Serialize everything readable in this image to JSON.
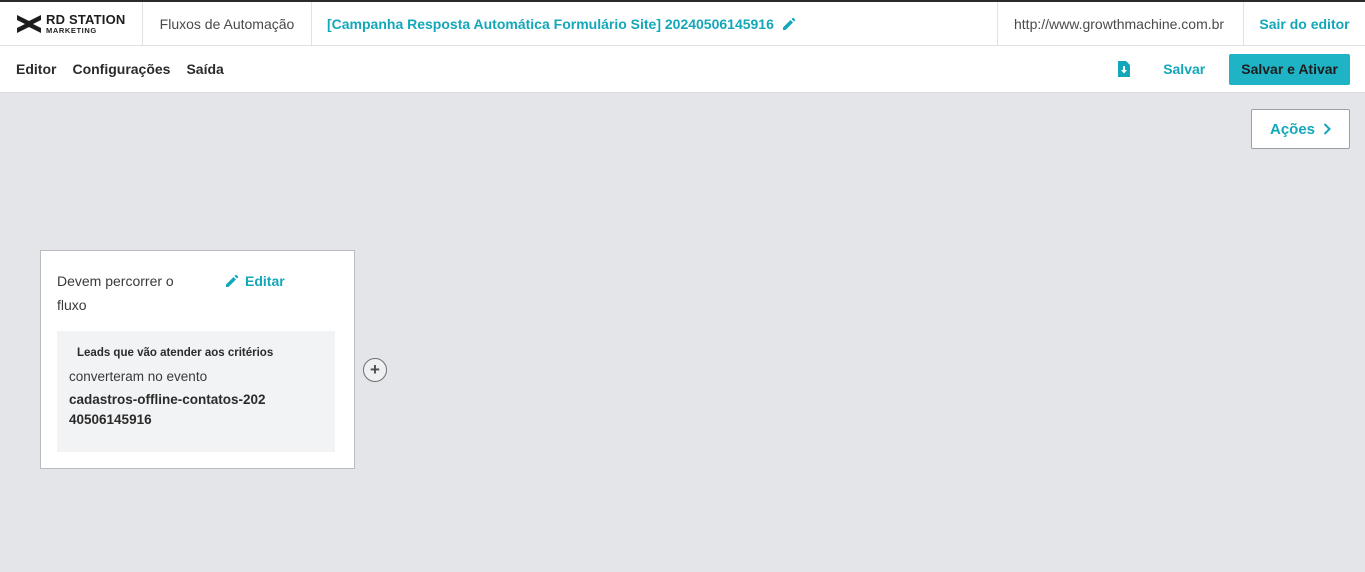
{
  "header": {
    "logo_line1": "RD STATION",
    "logo_line2": "MARKETING",
    "breadcrumb": "Fluxos de Automação",
    "flow_title": "[Campanha Resposta Automática Formulário Site] 20240506145916",
    "site_url": "http://www.growthmachine.com.br",
    "exit_label": "Sair do editor"
  },
  "toolbar": {
    "tabs": [
      {
        "label": "Editor"
      },
      {
        "label": "Configurações"
      },
      {
        "label": "Saída"
      }
    ],
    "save_label": "Salvar",
    "save_activate_label": "Salvar e Ativar"
  },
  "actions_button": {
    "label": "Ações"
  },
  "entry_card": {
    "title": "Devem percorrer o fluxo",
    "edit_label": "Editar",
    "criteria_heading": "Leads que vão atender aos critérios",
    "criteria_line": "converteram no evento",
    "criteria_event": "cadastros-offline-contatos-20240506145916"
  },
  "add_node": {
    "symbol": "+"
  },
  "colors": {
    "accent": "#13a7b9",
    "button_bg": "#1fb3c6",
    "canvas_bg": "#e4e5e8"
  }
}
